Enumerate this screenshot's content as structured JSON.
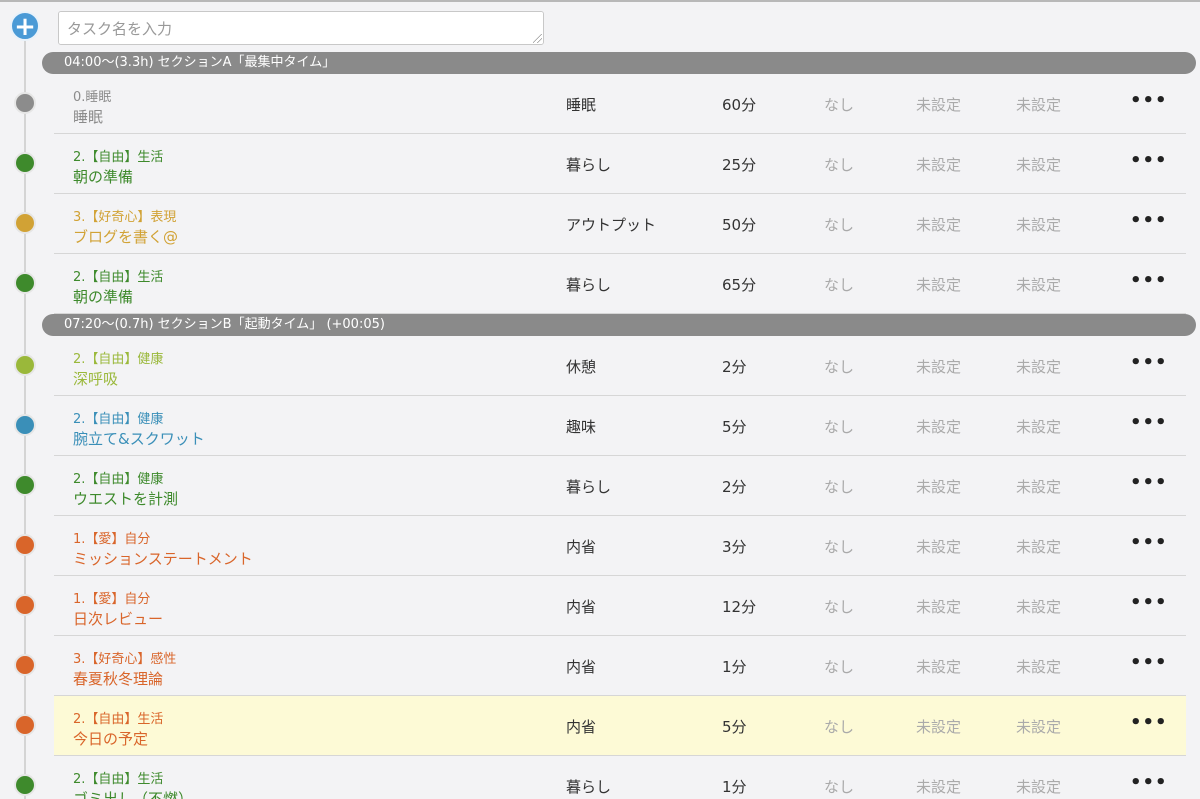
{
  "input": {
    "placeholder": "タスク名を入力"
  },
  "add_button": {
    "label": "+"
  },
  "sections": [
    {
      "label": "04:00〜(3.3h) セクションA「最集中タイム」"
    },
    {
      "label": "07:20〜(0.7h) セクションB「起動タイム」 (+00:05)"
    }
  ],
  "tasks": [
    {
      "category": "0.睡眠",
      "name": "睡眠",
      "type": "睡眠",
      "duration": "60分",
      "col_a": "なし",
      "col_b": "未設定",
      "col_c": "未設定",
      "color": "#8c8c8c",
      "more": "•••"
    },
    {
      "category": "2.【自由】生活",
      "name": "朝の準備",
      "type": "暮らし",
      "duration": "25分",
      "col_a": "なし",
      "col_b": "未設定",
      "col_c": "未設定",
      "color": "#3e8a2c",
      "more": "•••"
    },
    {
      "category": "3.【好奇心】表現",
      "name": "ブログを書く@",
      "type": "アウトプット",
      "duration": "50分",
      "col_a": "なし",
      "col_b": "未設定",
      "col_c": "未設定",
      "color": "#d1a235",
      "more": "•••"
    },
    {
      "category": "2.【自由】生活",
      "name": "朝の準備",
      "type": "暮らし",
      "duration": "65分",
      "col_a": "なし",
      "col_b": "未設定",
      "col_c": "未設定",
      "color": "#3e8a2c",
      "more": "•••"
    },
    {
      "category": "2.【自由】健康",
      "name": "深呼吸",
      "type": "休憩",
      "duration": "2分",
      "col_a": "なし",
      "col_b": "未設定",
      "col_c": "未設定",
      "color": "#9ab83a",
      "more": "•••"
    },
    {
      "category": "2.【自由】健康",
      "name": "腕立て&スクワット",
      "type": "趣味",
      "duration": "5分",
      "col_a": "なし",
      "col_b": "未設定",
      "col_c": "未設定",
      "color": "#3a8fb8",
      "more": "•••"
    },
    {
      "category": "2.【自由】健康",
      "name": "ウエストを計測",
      "type": "暮らし",
      "duration": "2分",
      "col_a": "なし",
      "col_b": "未設定",
      "col_c": "未設定",
      "color": "#3e8a2c",
      "more": "•••"
    },
    {
      "category": "1.【愛】自分",
      "name": "ミッションステートメント",
      "type": "内省",
      "duration": "3分",
      "col_a": "なし",
      "col_b": "未設定",
      "col_c": "未設定",
      "color": "#d9652a",
      "more": "•••"
    },
    {
      "category": "1.【愛】自分",
      "name": "日次レビュー",
      "type": "内省",
      "duration": "12分",
      "col_a": "なし",
      "col_b": "未設定",
      "col_c": "未設定",
      "color": "#d9652a",
      "more": "•••"
    },
    {
      "category": "3.【好奇心】感性",
      "name": "春夏秋冬理論",
      "type": "内省",
      "duration": "1分",
      "col_a": "なし",
      "col_b": "未設定",
      "col_c": "未設定",
      "color": "#d9652a",
      "more": "•••"
    },
    {
      "category": "2.【自由】生活",
      "name": "今日の予定",
      "type": "内省",
      "duration": "5分",
      "col_a": "なし",
      "col_b": "未設定",
      "col_c": "未設定",
      "color": "#d9652a",
      "more": "•••"
    },
    {
      "category": "2.【自由】生活",
      "name": "ゴミ出し（不燃）",
      "type": "暮らし",
      "duration": "1分",
      "col_a": "なし",
      "col_b": "未設定",
      "col_c": "未設定",
      "color": "#3e8a2c",
      "more": "•••"
    }
  ]
}
